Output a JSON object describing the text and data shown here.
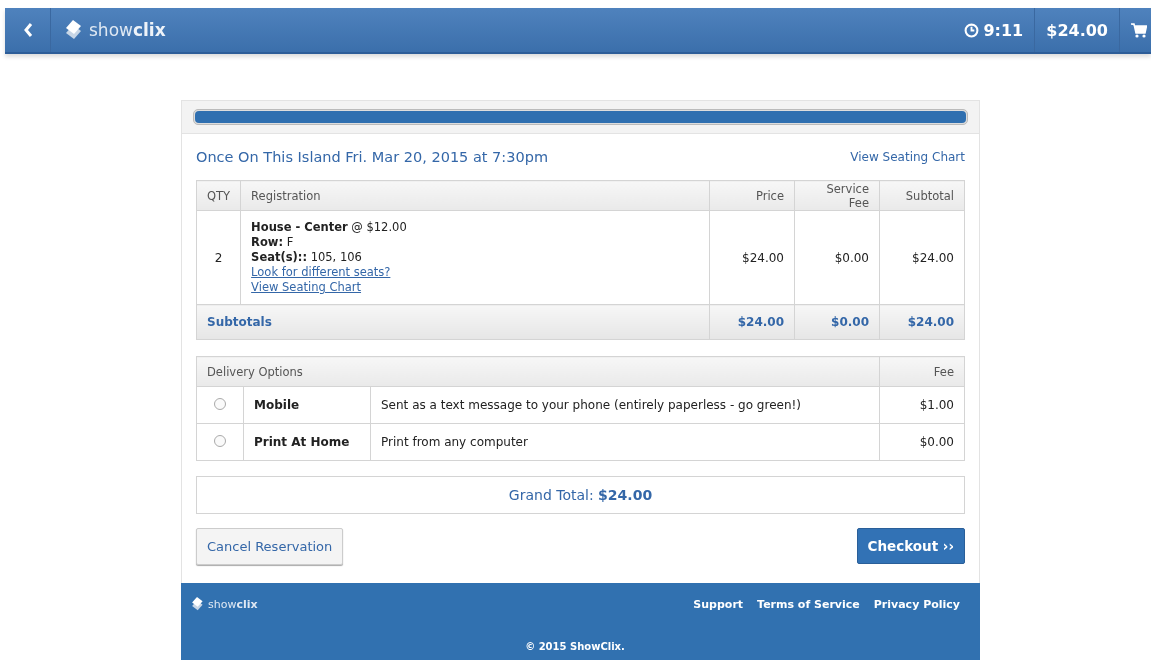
{
  "top_bar": {
    "logo": "show**clix**",
    "timer": "9:11",
    "cart_total": "$24.00"
  },
  "progress": {
    "level": 1
  },
  "event": {
    "title": "Once On This Island Fri. Mar 20, 2015 at 7:30pm",
    "seating_link": "View Seating Chart"
  },
  "order_table": {
    "columns": [
      "QTY",
      "Registration",
      "Price",
      "Service Fee",
      "Subtotal"
    ],
    "rows": [
      {
        "qty": "2",
        "details": [
          "**House - Center** @ $12.00",
          "**Row:** F",
          "**Seat(s)::** 105, 106"
        ],
        "links": [
          "Look for different seats?",
          "View Seating Chart"
        ],
        "price": "$24.00",
        "service_fee": "$0.00",
        "subtotal": "$24.00"
      }
    ],
    "totals": {
      "label": "Subtotals",
      "price": "$24.00",
      "service_fee": "$0.00",
      "subtotal": "$24.00"
    }
  },
  "delivery": {
    "columns": [
      "Delivery Options",
      "Fee"
    ],
    "options": [
      {
        "name": "Mobile",
        "description": "Sent as a text message to your phone (entirely paperless - go green!)",
        "fee": "$1.00",
        "selected": false
      },
      {
        "name": "Print At Home",
        "description": "Print from any computer",
        "fee": "$0.00",
        "selected": false
      }
    ]
  },
  "grand_total": "Grand Total: **$24.00**",
  "buttons": {
    "cancel": "Cancel Reservation",
    "checkout": "Checkout ››"
  },
  "footer": {
    "logo": "show**clix**",
    "links": [
      "Support",
      "Terms of Service",
      "Privacy Policy"
    ],
    "copyright": "© 2015 ShowClix."
  }
}
